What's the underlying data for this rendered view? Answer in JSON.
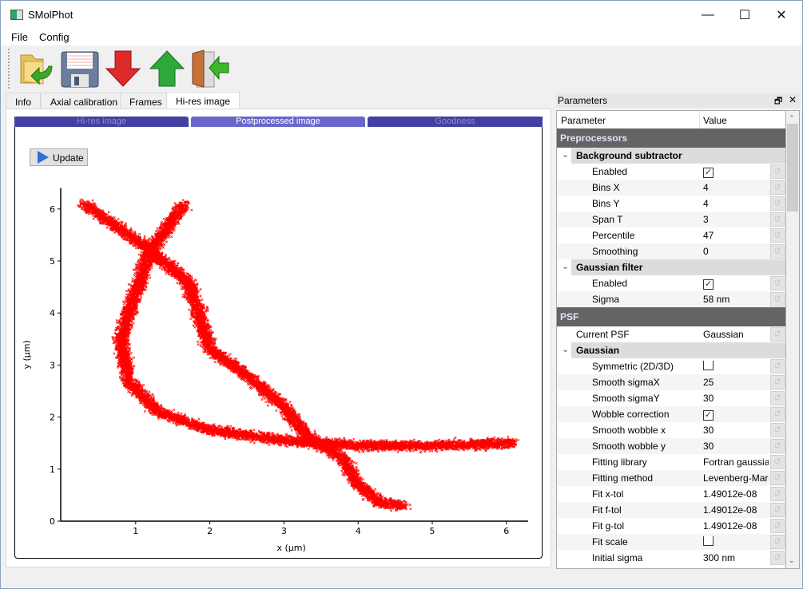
{
  "window": {
    "title": "SMolPhot",
    "minimize": "—",
    "maximize": "☐",
    "close": "✕"
  },
  "menu": [
    "File",
    "Config"
  ],
  "toolbar": [
    {
      "name": "open-icon",
      "tip": "open"
    },
    {
      "name": "save-icon",
      "tip": "save"
    },
    {
      "name": "arrow-down-icon",
      "tip": "down"
    },
    {
      "name": "arrow-up-icon",
      "tip": "up"
    },
    {
      "name": "exit-door-icon",
      "tip": "exit"
    }
  ],
  "tabs": [
    "Info",
    "Axial calibration",
    "Frames",
    "Hi-res image"
  ],
  "active_tab": "Hi-res image",
  "subtabs": [
    "Hi-res image",
    "Postprocessed image",
    "Goodness"
  ],
  "active_subtab": "Postprocessed image",
  "update_label": "Update",
  "plot": {
    "type": "scatter",
    "xlabel": "x (µm)",
    "ylabel": "y (µm)",
    "xticks": [
      "1",
      "2",
      "3",
      "4",
      "5",
      "6"
    ],
    "yticks": [
      "0",
      "1",
      "2",
      "3",
      "4",
      "5",
      "6"
    ],
    "xlim": [
      0,
      6.5
    ],
    "ylim": [
      0,
      6.4
    ],
    "marker_color": "#ff0000",
    "marker": "x",
    "curves": [
      [
        [
          1.65,
          6.1
        ],
        [
          1.2,
          5.2
        ],
        [
          0.95,
          4.2
        ],
        [
          0.8,
          3.5
        ],
        [
          0.9,
          2.7
        ],
        [
          1.3,
          2.1
        ],
        [
          2,
          1.75
        ],
        [
          3,
          1.55
        ],
        [
          4,
          1.45
        ],
        [
          5,
          1.45
        ],
        [
          6.1,
          1.5
        ]
      ],
      [
        [
          0.3,
          6.1
        ],
        [
          1.2,
          5.2
        ],
        [
          1.7,
          4.6
        ],
        [
          1.85,
          4.0
        ],
        [
          2.0,
          3.3
        ],
        [
          2.5,
          2.8
        ],
        [
          3.0,
          2.2
        ],
        [
          3.3,
          1.65
        ],
        [
          3.8,
          1.2
        ],
        [
          4.0,
          0.7
        ],
        [
          4.3,
          0.35
        ],
        [
          4.6,
          0.3
        ]
      ]
    ]
  },
  "params": {
    "title": "Parameters",
    "float": "🗗",
    "close": "✕",
    "col_param": "Parameter",
    "col_value": "Value",
    "rows": [
      {
        "type": "sec",
        "name": "Preprocessors"
      },
      {
        "type": "grp",
        "name": "Background subtractor"
      },
      {
        "type": "item",
        "name": "Enabled",
        "check": true,
        "indent": 2
      },
      {
        "type": "item",
        "name": "Bins X",
        "value": "4",
        "indent": 2
      },
      {
        "type": "item",
        "name": "Bins Y",
        "value": "4",
        "indent": 2
      },
      {
        "type": "item",
        "name": "Span T",
        "value": "3",
        "indent": 2
      },
      {
        "type": "item",
        "name": "Percentile",
        "value": "47",
        "indent": 2
      },
      {
        "type": "item",
        "name": "Smoothing",
        "value": "0",
        "indent": 2
      },
      {
        "type": "grp",
        "name": "Gaussian filter"
      },
      {
        "type": "item",
        "name": "Enabled",
        "check": true,
        "indent": 2
      },
      {
        "type": "item",
        "name": "Sigma",
        "value": "58 nm",
        "indent": 2
      },
      {
        "type": "sec",
        "name": "PSF"
      },
      {
        "type": "item",
        "name": "Current PSF",
        "value": "Gaussian",
        "indent": 1
      },
      {
        "type": "grp",
        "name": "Gaussian"
      },
      {
        "type": "item",
        "name": "Symmetric (2D/3D)",
        "check": false,
        "indent": 2
      },
      {
        "type": "item",
        "name": "Smooth sigmaX",
        "value": "25",
        "indent": 2
      },
      {
        "type": "item",
        "name": "Smooth sigmaY",
        "value": "30",
        "indent": 2
      },
      {
        "type": "item",
        "name": "Wobble correction",
        "check": true,
        "indent": 2
      },
      {
        "type": "item",
        "name": "Smooth wobble x",
        "value": "30",
        "indent": 2
      },
      {
        "type": "item",
        "name": "Smooth wobble y",
        "value": "30",
        "indent": 2
      },
      {
        "type": "item",
        "name": "Fitting library",
        "value": "Fortran gaussian",
        "indent": 2
      },
      {
        "type": "item",
        "name": "Fitting method",
        "value": "Levenberg-Marquardt",
        "indent": 2
      },
      {
        "type": "item",
        "name": "Fit x-tol",
        "value": "1.49012e-08",
        "indent": 2
      },
      {
        "type": "item",
        "name": "Fit f-tol",
        "value": "1.49012e-08",
        "indent": 2
      },
      {
        "type": "item",
        "name": "Fit g-tol",
        "value": "1.49012e-08",
        "indent": 2
      },
      {
        "type": "item",
        "name": "Fit scale",
        "check": false,
        "indent": 2
      },
      {
        "type": "item",
        "name": "Initial sigma",
        "value": "300 nm",
        "indent": 2
      }
    ]
  }
}
